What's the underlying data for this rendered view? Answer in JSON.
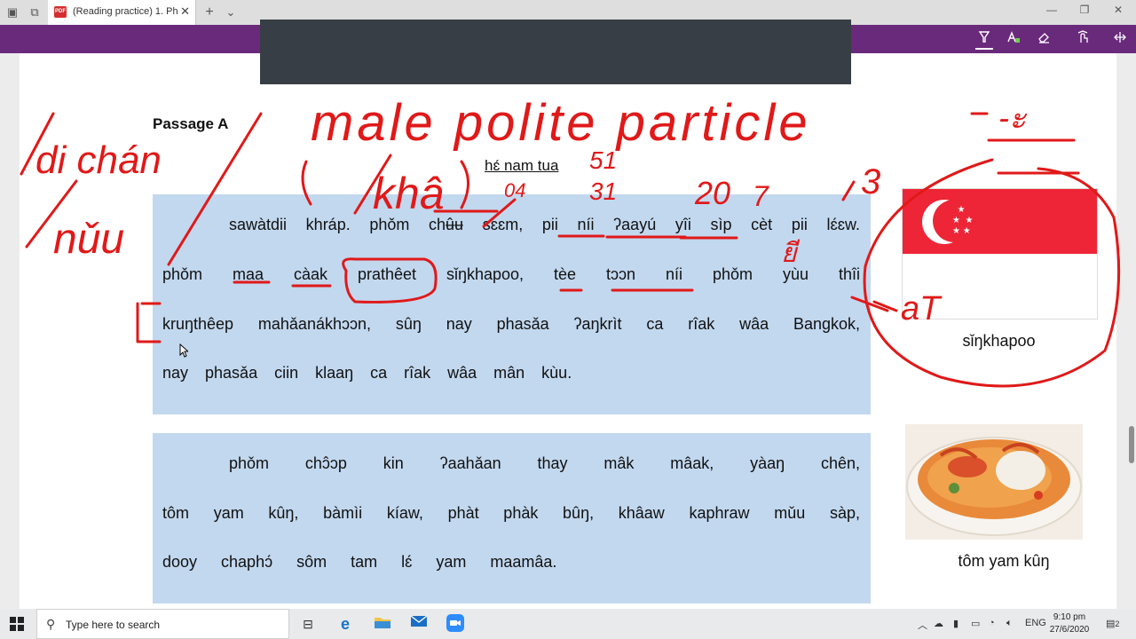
{
  "browser": {
    "tab_title": "(Reading practice) 1. Ph",
    "tab_close": "✕",
    "new_tab": "+",
    "tab_menu": "⌄",
    "window_controls": {
      "minimize": "—",
      "restore": "❐",
      "close": "✕"
    }
  },
  "pdf_toolbar": {
    "tools": [
      "highlighter-icon",
      "text-highlight-icon",
      "eraser-icon",
      "touch-write-icon",
      "fullscreen-icon"
    ]
  },
  "document": {
    "heading": "Passage A",
    "subtitle": "hɛ́ nam tua",
    "passage1": [
      "sawàtdii khráp. phǒm chʉ̂ʉ sɛɛm, pii níi ʔaayú yîi sìp cèt pii lɛ́ɛw.",
      "phǒm maa càak prathêet sǐŋkhapoo, tèe tɔɔn níi phǒm yùu thîi",
      "kruŋthêep mahǎanákhɔɔn, sûŋ nay phasǎa ʔaŋkrìt ca rîak wâa Bangkok,",
      "nay phasǎa ciin klaaŋ ca rîak wâa mân kùu."
    ],
    "passage2": [
      "phǒm chɔ̂ɔp kin ʔaahǎan thay mâk mâak, yàaŋ chên,",
      "tôm yam kûŋ, bàmìi kíaw, phàt phàk bûŋ, khâaw kaphraw mǔu sàp,",
      "dooy chaphɔ́ sôm tam lɛ́ yam maamâa."
    ],
    "flag_caption": "sǐŋkhapoo",
    "food_caption": "tôm yam kûŋ"
  },
  "annotations": {
    "left_note": [
      "di chán",
      "nǔu"
    ],
    "top_note": "male polite particle",
    "khaa": "khâ",
    "thai_char": "-ะ",
    "numbers": [
      "51",
      "31",
      "04",
      "20",
      "7",
      "3"
    ],
    "thai_small": "ยี",
    "at": "aT"
  },
  "taskbar": {
    "search_placeholder": "Type here to search",
    "lang": "ENG",
    "time": "9:10 pm",
    "date": "27/6/2020",
    "notif_count": "2"
  },
  "colors": {
    "toolbar": "#6a2a7b",
    "passage_bg": "#c2d8ef",
    "ink": "#e01919",
    "flag_red": "#ee2536"
  }
}
